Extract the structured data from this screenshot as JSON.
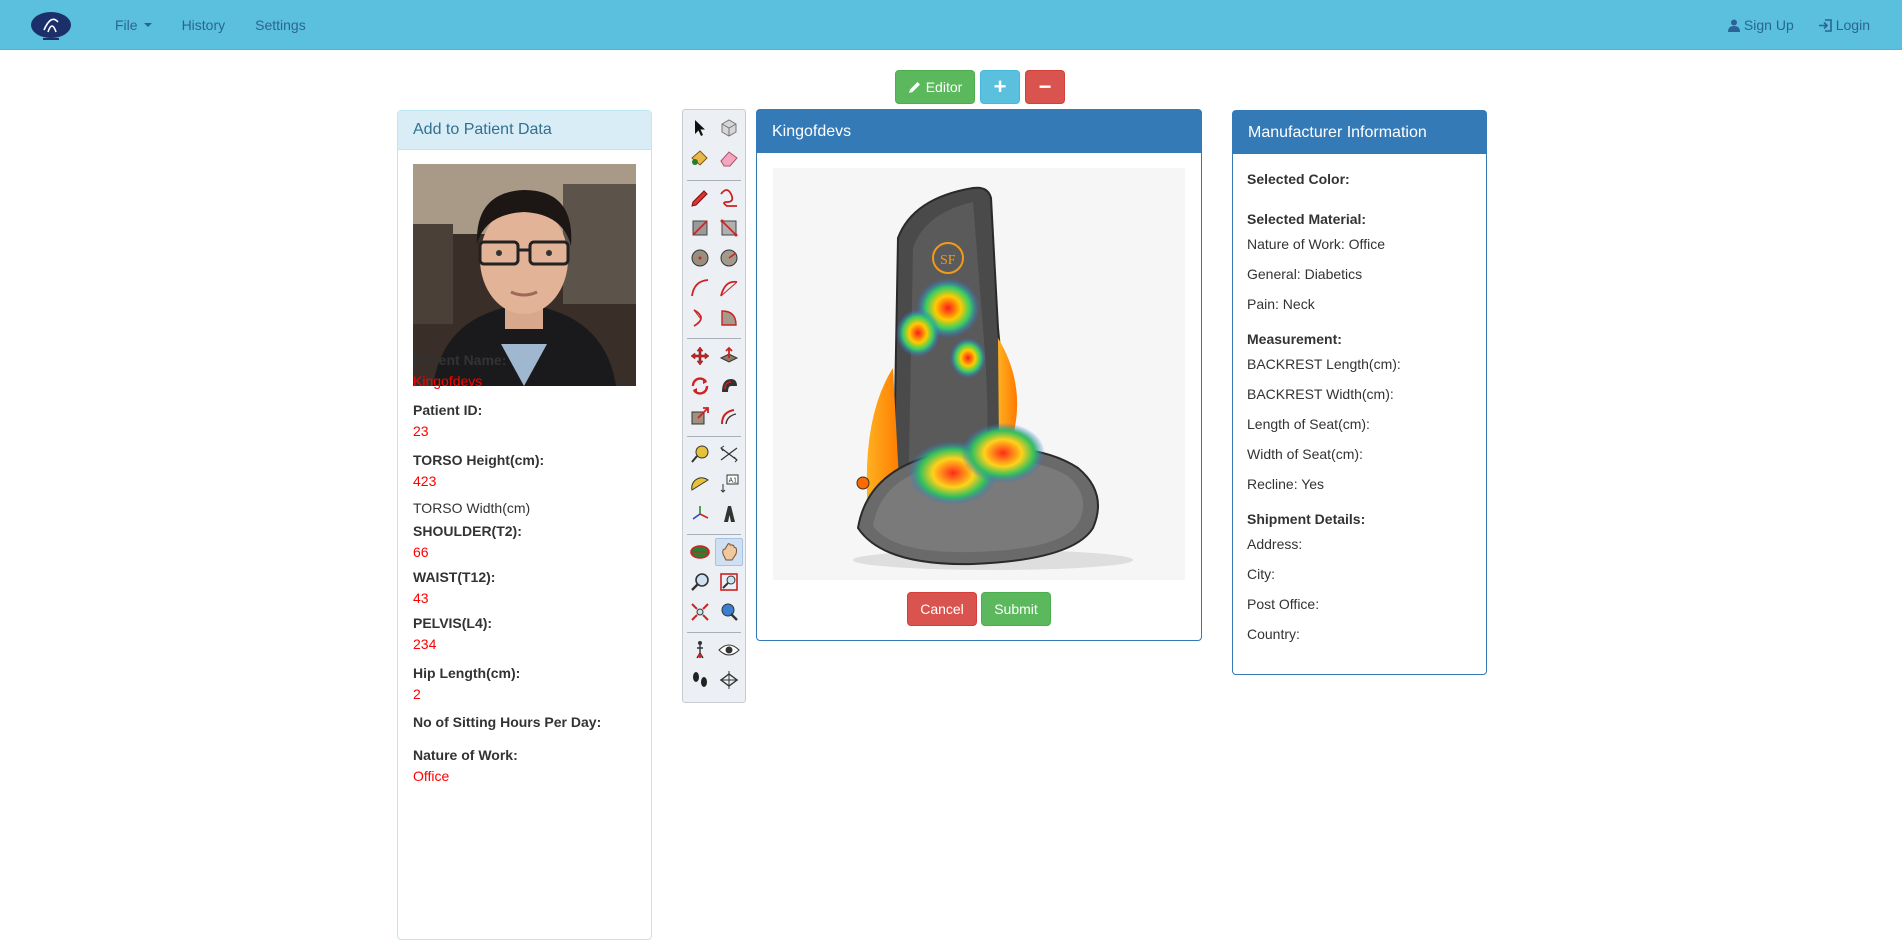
{
  "nav": {
    "file": "File",
    "history": "History",
    "settings": "Settings",
    "signup": "Sign Up",
    "login": "Login"
  },
  "toolbar_buttons": {
    "editor": "Editor",
    "add": "+",
    "remove": "−"
  },
  "patient_panel": {
    "title": "Add to Patient Data",
    "fields": [
      {
        "label": "Patient Name:",
        "value": "Kingofdevs"
      },
      {
        "label": "Patient ID:",
        "value": "23"
      },
      {
        "label": "TORSO Height(cm):",
        "value": "423"
      },
      {
        "label": "TORSO Width(cm)"
      },
      {
        "label": "SHOULDER(T2):",
        "value": "66"
      },
      {
        "label": "WAIST(T12):",
        "value": "43"
      },
      {
        "label": "PELVIS(L4):",
        "value": "234"
      },
      {
        "label": "Hip Length(cm):",
        "value": "2"
      },
      {
        "label": "No of Sitting Hours Per Day:"
      },
      {
        "label": "Nature of Work:",
        "value": "Office"
      }
    ]
  },
  "editor_panel": {
    "title": "Kingofdevs",
    "logo_text": "SF",
    "cancel": "Cancel",
    "submit": "Submit"
  },
  "manufacturer_panel": {
    "title": "Manufacturer Information",
    "selected_color_label": "Selected Color:",
    "selected_material_label": "Selected Material:",
    "nature_of_work": "Nature of Work: Office",
    "general": "General: Diabetics",
    "pain": "Pain: Neck",
    "measurement_label": "Measurement:",
    "backrest_length": "BACKREST Length(cm):",
    "backrest_width": "BACKREST Width(cm):",
    "seat_length": "Length of Seat(cm):",
    "seat_width": "Width of Seat(cm):",
    "recline": "Recline: Yes",
    "shipment_label": "Shipment Details:",
    "address": "Address:",
    "city": "City:",
    "post_office": "Post Office:",
    "country": "Country:"
  },
  "colors": {
    "navbar": "#5bc0de",
    "primary": "#337ab7",
    "success": "#5cb85c",
    "danger": "#d9534f",
    "patient_value": "#ff0000"
  }
}
